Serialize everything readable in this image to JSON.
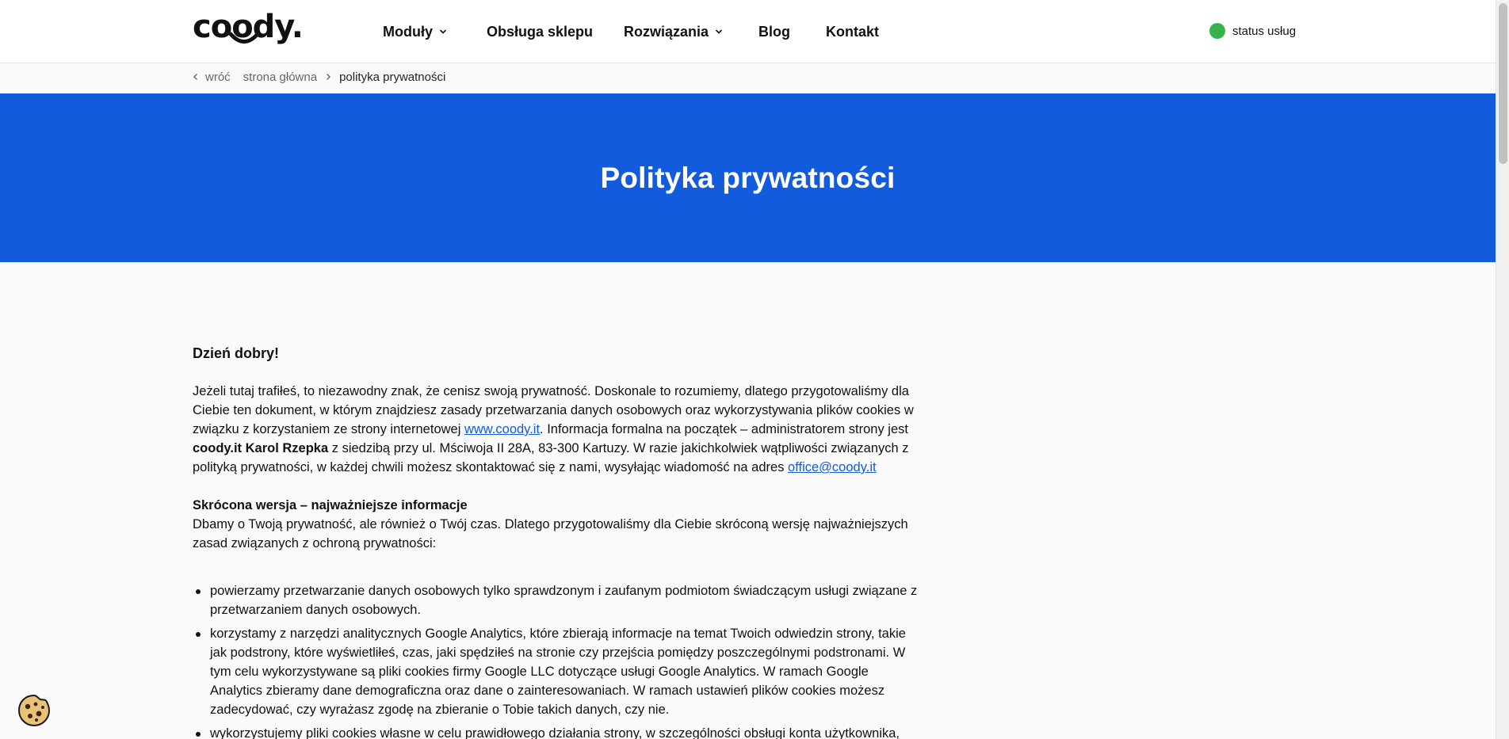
{
  "header": {
    "logo_text": "coody.",
    "nav": [
      {
        "label": "Moduły",
        "has_dropdown": true
      },
      {
        "label": "Obsługa sklepu",
        "has_dropdown": false
      },
      {
        "label": "Rozwiązania",
        "has_dropdown": true
      },
      {
        "label": "Blog",
        "has_dropdown": false
      },
      {
        "label": "Kontakt",
        "has_dropdown": false
      }
    ],
    "status_label": "status usług",
    "status_color": "#36b34a"
  },
  "breadcrumb": {
    "back_label": "wróć",
    "home_label": "strona główna",
    "current_label": "polityka prywatności"
  },
  "hero": {
    "title": "Polityka prywatności",
    "background": "#125bdd"
  },
  "content": {
    "greeting": "Dzień dobry!",
    "intro": {
      "part1": "Jeżeli tutaj trafiłeś, to niezawodny znak, że cenisz swoją prywatność. Doskonale to rozumiemy, dlatego przygotowaliśmy dla Ciebie ten dokument, w którym znajdziesz zasady przetwarzania danych osobowych oraz wykorzystywania plików cookies w związku z korzystaniem ze strony internetowej ",
      "site_link": "www.coody.it",
      "part2": ". Informacja formalna na początek – administratorem strony jest ",
      "company_bold": "coody.it Karol Rzepka",
      "part3": " z siedzibą przy ul. Mściwoja II 28A, 83-300 Kartuzy. W razie jakichkolwiek wątpliwości związanych z polityką prywatności, w każdej chwili możesz skontaktować się z nami, wysyłając wiadomość na adres ",
      "email_link": "office@coody.it"
    },
    "short_version_heading": "Skrócona wersja – najważniejsze informacje",
    "short_version_lead": "Dbamy o Twoją prywatność, ale również o Twój czas. Dlatego przygotowaliśmy dla Ciebie skróconą wersję najważniejszych zasad związanych z ochroną prywatności:",
    "bullets": [
      "powierzamy przetwarzanie danych osobowych tylko sprawdzonym i zaufanym podmiotom świadczącym usługi związane z przetwarzaniem danych osobowych.",
      "korzystamy z narzędzi analitycznych Google Analytics, które zbierają informacje na temat Twoich odwiedzin strony, takie jak podstrony, które wyświetliłeś, czas, jaki spędziłeś na stronie czy przejścia pomiędzy poszczególnymi podstronami. W tym celu wykorzystywane są pliki cookies firmy Google LLC dotyczące usługi Google Analytics. W ramach Google Analytics zbieramy dane demograficzna oraz dane o zainteresowaniach. W ramach ustawień plików cookies możesz zadecydować, czy wyrażasz zgodę na zbieranie o Tobie takich danych, czy nie.",
      "wykorzystujemy pliki cookies własne w celu prawidłowego działania strony, w szczególności obsługi konta użytkownika,"
    ]
  }
}
